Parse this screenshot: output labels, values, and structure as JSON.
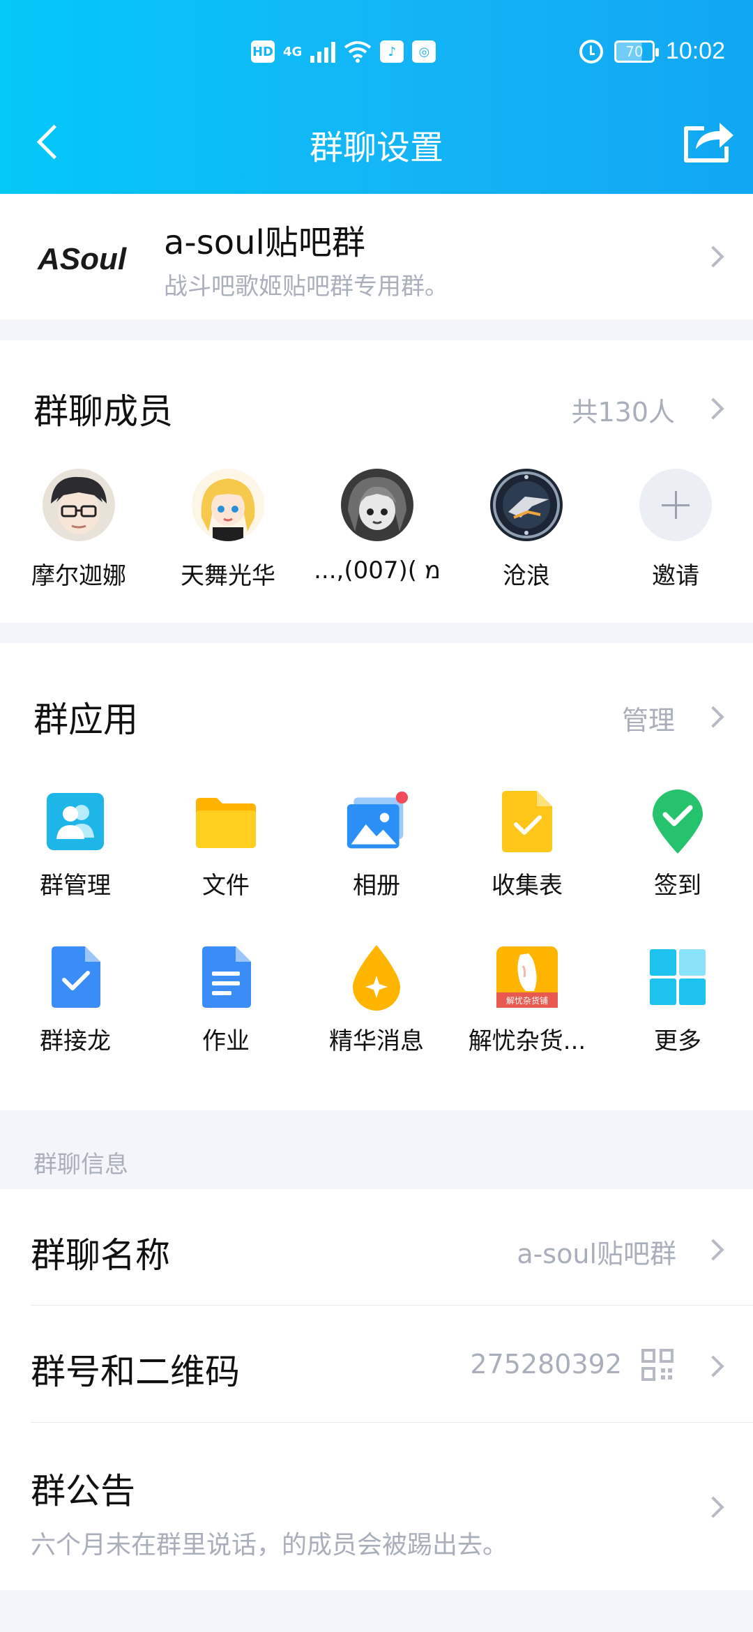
{
  "status_bar": {
    "hd_label": "HD",
    "network_label": "4G",
    "battery_level": "70",
    "time": "10:02"
  },
  "header": {
    "title": "群聊设置"
  },
  "group": {
    "logo_text": "ASoul",
    "name": "a-soul贴吧群",
    "description": "战斗吧歌姬贴吧群专用群。"
  },
  "members": {
    "title": "群聊成员",
    "count_label": "共130人",
    "items": [
      {
        "name": "摩尔迦娜"
      },
      {
        "name": "天舞光华"
      },
      {
        "name": "...,מ )(007)"
      },
      {
        "name": "沧浪"
      }
    ],
    "invite_label": "邀请"
  },
  "apps": {
    "title": "群应用",
    "manage_label": "管理",
    "items": [
      {
        "label": "群管理",
        "icon": "group-manage-icon",
        "color": "#1eb6e9"
      },
      {
        "label": "文件",
        "icon": "folder-icon",
        "color": "#ffc300"
      },
      {
        "label": "相册",
        "icon": "album-icon",
        "color": "#2a8ff7"
      },
      {
        "label": "收集表",
        "icon": "form-icon",
        "color": "#ffc61a"
      },
      {
        "label": "签到",
        "icon": "checkin-icon",
        "color": "#25c36b"
      },
      {
        "label": "群接龙",
        "icon": "solitaire-icon",
        "color": "#3a8df6"
      },
      {
        "label": "作业",
        "icon": "homework-icon",
        "color": "#3a8df6"
      },
      {
        "label": "精华消息",
        "icon": "essence-icon",
        "color": "#ffb400"
      },
      {
        "label": "解忧杂货...",
        "icon": "shop-icon",
        "color": "#ffb400"
      },
      {
        "label": "更多",
        "icon": "more-grid-icon",
        "color": "#1ec2ee"
      }
    ],
    "shop_icon_text": "解忧杂货铺"
  },
  "info": {
    "section_label": "群聊信息",
    "name_title": "群聊名称",
    "name_value": "a-soul贴吧群",
    "number_title": "群号和二维码",
    "number_value": "275280392",
    "notice_title": "群公告",
    "notice_value": "六个月未在群里说话，的成员会被踢出去。"
  },
  "colors": {
    "header_start": "#03c8f8",
    "header_end": "#11a7f3",
    "page_bg": "#f4f5fa",
    "secondary_text": "#a9afba"
  }
}
